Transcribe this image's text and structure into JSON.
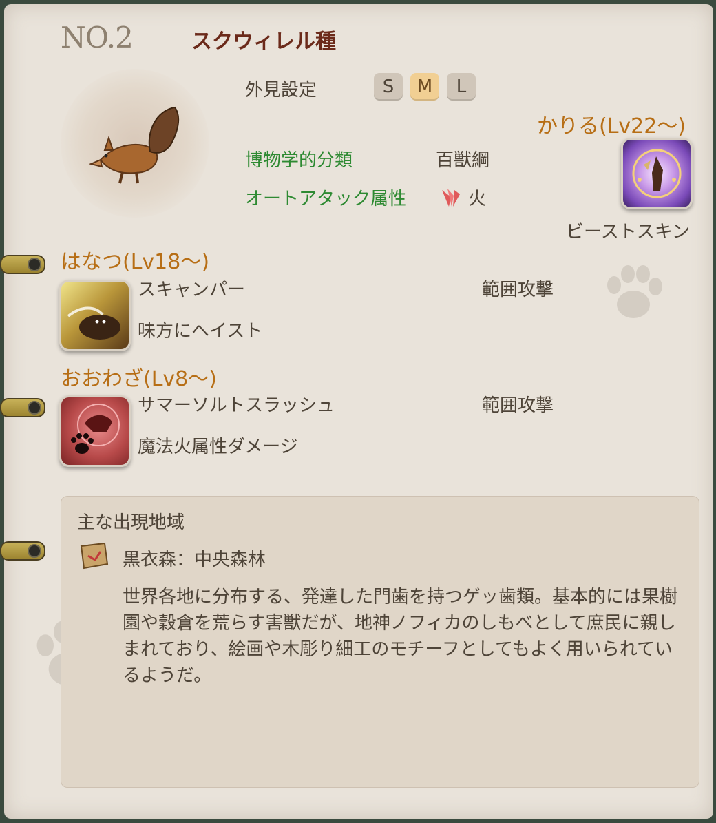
{
  "entry": {
    "number": "NO.2",
    "species": "スクウィレル種"
  },
  "appearance": {
    "label": "外見設定",
    "sizes": [
      "S",
      "M",
      "L"
    ],
    "selected": "M"
  },
  "classification": {
    "label": "博物学的分類",
    "value": "百獣綱"
  },
  "autoattack": {
    "label": "オートアタック属性",
    "element_icon": "fire-claw-icon",
    "value": "火"
  },
  "kariru": {
    "heading": "かりる(Lv22～)",
    "icon": "beast-skin-icon",
    "name": "ビーストスキン"
  },
  "hanatsu": {
    "heading": "はなつ(Lv18～)",
    "icon": "scamper-icon",
    "name": "スキャンパー",
    "type": "範囲攻撃",
    "description": "味方にヘイスト"
  },
  "oowaza": {
    "heading": "おおわざ(Lv8～)",
    "icon": "somersault-slash-icon",
    "name": "サマーソルトスラッシュ",
    "type": "範囲攻撃",
    "description": "魔法火属性ダメージ"
  },
  "habitat": {
    "title": "主な出現地域",
    "icon": "map-scroll-icon",
    "place": "黒衣森：中央森林",
    "description": "世界各地に分布する、発達した門歯を持つゲッ歯類。基本的には果樹園や穀倉を荒らす害獣だが、地神ノフィカのしもべとして庶民に親しまれており、絵画や木彫り細工のモチーフとしてもよく用いられているようだ。"
  },
  "colors": {
    "page": "#e9e3da",
    "species": "#6b2a1a",
    "green": "#2e8a32",
    "orange": "#b76e15",
    "selected_size": "#f1cf93"
  }
}
